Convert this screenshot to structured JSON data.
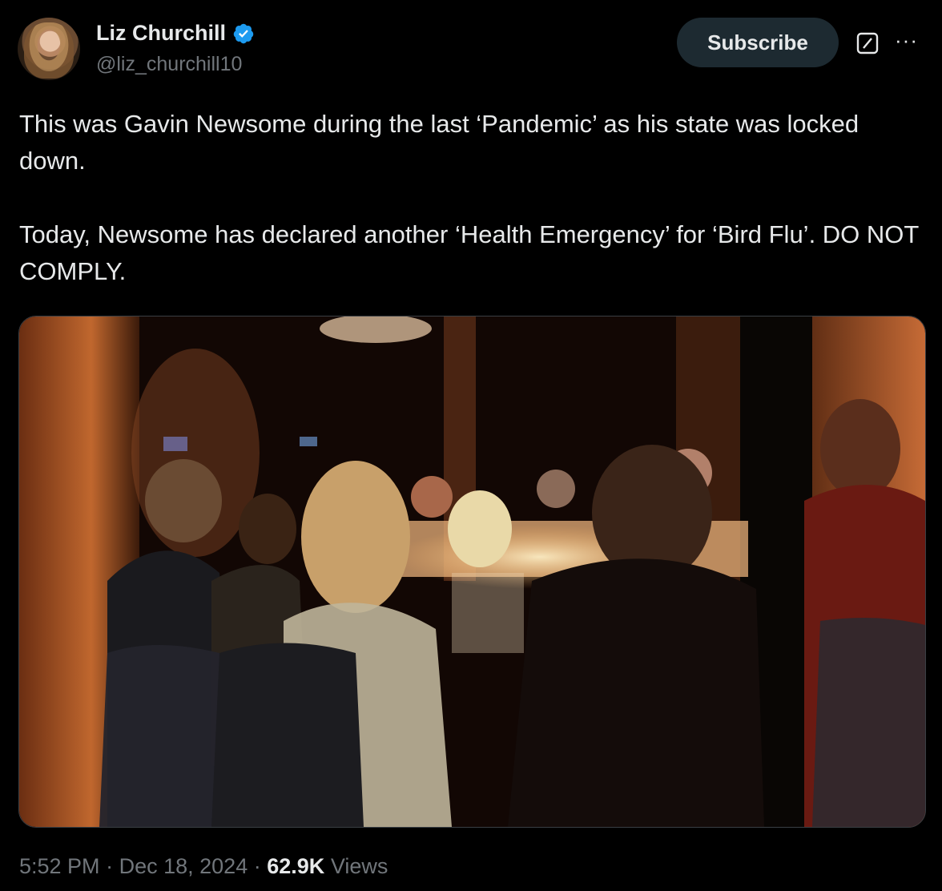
{
  "author": {
    "display_name": "Liz Churchill",
    "handle": "@liz_churchill10",
    "verified": true,
    "avatar_icon": "profile-photo"
  },
  "actions": {
    "subscribe_label": "Subscribe",
    "grok_icon": "grok-icon",
    "more_icon": "more-icon"
  },
  "tweet": {
    "text": "This was Gavin Newsome during the last ‘Pandemic’ as his state was locked down.\n\nToday, Newsome has declared another ‘Health Emergency’ for ‘Bird Flu’. DO NOT COMPLY.",
    "media_description_icon": "restaurant-photo"
  },
  "meta": {
    "time": "5:52 PM",
    "separator": "·",
    "date": "Dec 18, 2024",
    "views_count": "62.9K",
    "views_label": "Views"
  },
  "colors": {
    "background": "#000000",
    "text": "#e7e9ea",
    "secondary_text": "#71767b",
    "verified_blue": "#1d9bf0",
    "subscribe_bg": "#1d2a31"
  }
}
